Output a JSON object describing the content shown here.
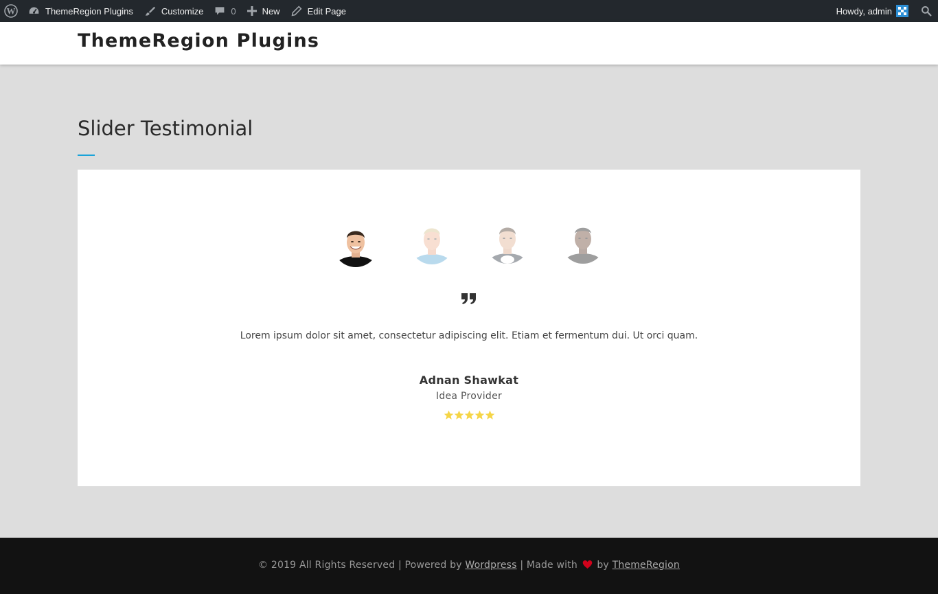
{
  "admin_bar": {
    "site_name": "ThemeRegion Plugins",
    "customize": "Customize",
    "comments_count": "0",
    "new": "New",
    "edit_page": "Edit Page",
    "howdy": "Howdy, admin"
  },
  "header": {
    "site_title": "ThemeRegion Plugins"
  },
  "page": {
    "title": "Slider Testimonial"
  },
  "testimonial": {
    "text": "Lorem ipsum dolor sit amet, consectetur adipiscing elit. Etiam et fermentum dui. Ut orci quam.",
    "author": "Adnan Shawkat",
    "role": "Idea Provider",
    "rating": 5,
    "rating_max": 5
  },
  "footer": {
    "copyright": "© 2019 All Rights Reserved | Powered by",
    "powered_link": "Wordpress",
    "made_with": "| Made with",
    "by": "by",
    "author_link": "ThemeRegion"
  },
  "colors": {
    "admin_bar": "#23282d",
    "accent": "#1aa3d9",
    "star": "#f5d547",
    "heart": "#d0021b",
    "footer": "#121212"
  }
}
